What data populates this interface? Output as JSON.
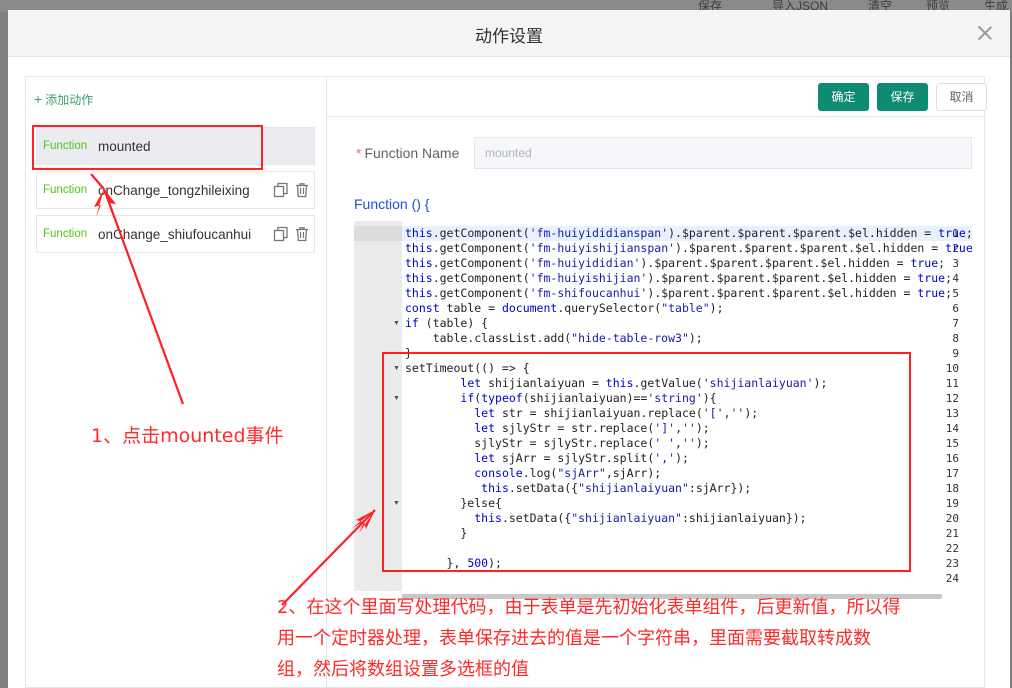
{
  "background_toolbar": {
    "items": [
      "保存",
      "导入JSON",
      "清空",
      "预览",
      "生成"
    ]
  },
  "dialog": {
    "title": "动作设置"
  },
  "sidebar": {
    "add_label": "添加动作",
    "functions": [
      {
        "tag": "Function",
        "name": "mounted"
      },
      {
        "tag": "Function",
        "name": "onChange_tongzhileixing"
      },
      {
        "tag": "Function",
        "name": "onChange_shiufoucanhui"
      }
    ]
  },
  "toolbar": {
    "confirm_label": "确定",
    "save_label": "保存",
    "cancel_label": "取消"
  },
  "form": {
    "name_label": "Function Name",
    "name_value": "mounted",
    "decl_label": "Function () {"
  },
  "editor": {
    "line_numbers": [
      "1",
      "2",
      "3",
      "4",
      "5",
      "6",
      "7",
      "8",
      "9",
      "10",
      "11",
      "12",
      "13",
      "14",
      "15",
      "16",
      "17",
      "18",
      "19",
      "20",
      "21",
      "22",
      "23",
      "24"
    ],
    "lines": [
      "this.getComponent('fm-huiyididianspan').$parent.$parent.$parent.$el.hidden = true;",
      "this.getComponent('fm-huiyishijianspan').$parent.$parent.$parent.$el.hidden = true;",
      "this.getComponent('fm-huiyididian').$parent.$parent.$parent.$el.hidden = true;",
      "this.getComponent('fm-huiyishijian').$parent.$parent.$parent.$el.hidden = true;",
      "this.getComponent('fm-shifoucanhui').$parent.$parent.$parent.$el.hidden = true;",
      "const table = document.querySelector(\"table\");",
      "if (table) {",
      "    table.classList.add(\"hide-table-row3\");",
      "}",
      "setTimeout(() => {",
      "        let shijianlaiyuan = this.getValue('shijianlaiyuan');",
      "        if(typeof(shijianlaiyuan)=='string'){",
      "          let str = shijianlaiyuan.replace('[','');",
      "          let sjlyStr = str.replace(']','');",
      "          sjlyStr = sjlyStr.replace(' ','');",
      "          let sjArr = sjlyStr.split(',');",
      "          console.log(\"sjArr\",sjArr);",
      "           this.setData({\"shijianlaiyuan\":sjArr});",
      "        }else{",
      "          this.setData({\"shijianlaiyuan\":shijianlaiyuan});",
      "        }",
      "",
      "      }, 500);",
      ""
    ]
  },
  "annotations": {
    "note1": "1、点击mounted事件",
    "note2_line1": "2、在这个里面写处理代码，由于表单是先初始化表单组件，后更新值，所以得",
    "note2_line2": "用一个定时器处理，表单保存进去的值是一个字符串，里面需要截取转成数",
    "note2_line3": "组，然后将数组设置多选框的值",
    "highlight_color": "#ff2020"
  },
  "colors": {
    "primary": "#0f8b73",
    "tag_green": "#52c41a",
    "link_blue": "#1b4fe0"
  }
}
